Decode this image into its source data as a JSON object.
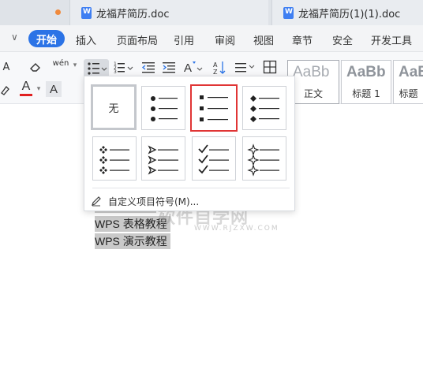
{
  "tabs": [
    {
      "title": "龙福芹简历.doc"
    },
    {
      "title": "龙福芹简历(1)(1).doc"
    }
  ],
  "menu": {
    "items": [
      "开始",
      "插入",
      "页面布局",
      "引用",
      "审阅",
      "视图",
      "章节",
      "安全",
      "开发工具"
    ],
    "active_index": 0
  },
  "toolbar": {
    "pinyin_label": "wén",
    "font_color_label": "A",
    "char_shade_label": "A",
    "styles": [
      {
        "sample": "AaBb",
        "name": "正文"
      },
      {
        "sample": "AaBb",
        "name": "标题 1"
      },
      {
        "sample": "AaB",
        "name": "标题"
      }
    ]
  },
  "bullet_panel": {
    "none_label": "无",
    "styles": [
      {
        "icon": "none"
      },
      {
        "icon": "filled-circle-bullet"
      },
      {
        "icon": "filled-square-bullet",
        "selected": true
      },
      {
        "icon": "filled-diamond-bullet"
      },
      {
        "icon": "four-diamond-bullet"
      },
      {
        "icon": "arrowhead-bullet"
      },
      {
        "icon": "checkmark-bullet"
      },
      {
        "icon": "star-outline-bullet"
      }
    ],
    "custom_label": "自定义项目符号(M)..."
  },
  "document": {
    "lines": [
      "WPS 表格教程",
      "WPS 演示教程"
    ]
  },
  "watermark": {
    "main": "软件自学网",
    "sub": "WWW.RJZXW.COM"
  },
  "colors": {
    "accent": "#2b73e6",
    "selection_border": "#e03535",
    "tab_dot": "#f08a3c"
  }
}
